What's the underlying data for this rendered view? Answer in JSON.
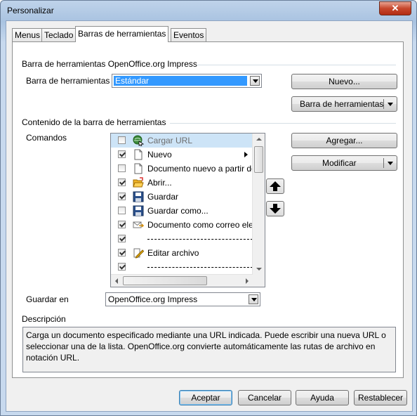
{
  "window": {
    "title": "Personalizar",
    "close_symbol": "✕"
  },
  "tabs": [
    "Menus",
    "Teclado",
    "Barras de herramientas",
    "Eventos"
  ],
  "toolbars_group": {
    "title": "Barra de herramientas OpenOffice.org Impress",
    "label": "Barra de herramientas",
    "selected": "Estándar",
    "new_button": "Nuevo...",
    "menu_button": "Barra de herramientas"
  },
  "contents_group": {
    "title": "Contenido de la barra de herramientas",
    "commands_label": "Comandos",
    "add_button": "Agregar...",
    "modify_button": "Modificar",
    "items": [
      {
        "label": "Cargar URL",
        "checked": false,
        "icon": "load-url-icon",
        "highlighted": true
      },
      {
        "label": "Nuevo",
        "checked": true,
        "icon": "new-document-icon",
        "submenu": true
      },
      {
        "label": "Documento nuevo a partir de plantilla",
        "checked": false,
        "icon": "document-template-icon"
      },
      {
        "label": "Abrir...",
        "checked": true,
        "icon": "open-folder-icon"
      },
      {
        "label": "Guardar",
        "checked": true,
        "icon": "save-icon"
      },
      {
        "label": "Guardar como...",
        "checked": false,
        "icon": "save-as-icon"
      },
      {
        "label": "Documento como correo electrónico",
        "checked": true,
        "icon": "email-document-icon"
      },
      {
        "label": "",
        "checked": true,
        "separator": true
      },
      {
        "label": "Editar archivo",
        "checked": true,
        "icon": "edit-file-icon"
      },
      {
        "label": "",
        "checked": true,
        "separator": true
      }
    ],
    "save_in_label": "Guardar en",
    "save_in_value": "OpenOffice.org Impress"
  },
  "description": {
    "label": "Descripción",
    "text": "Carga un documento especificado mediante una URL indicada. Puede escribir una nueva URL o seleccionar una de la lista. OpenOffice.org convierte automáticamente las rutas de archivo en notación URL."
  },
  "footer": {
    "accept": "Aceptar",
    "cancel": "Cancelar",
    "help": "Ayuda",
    "reset": "Restablecer"
  }
}
